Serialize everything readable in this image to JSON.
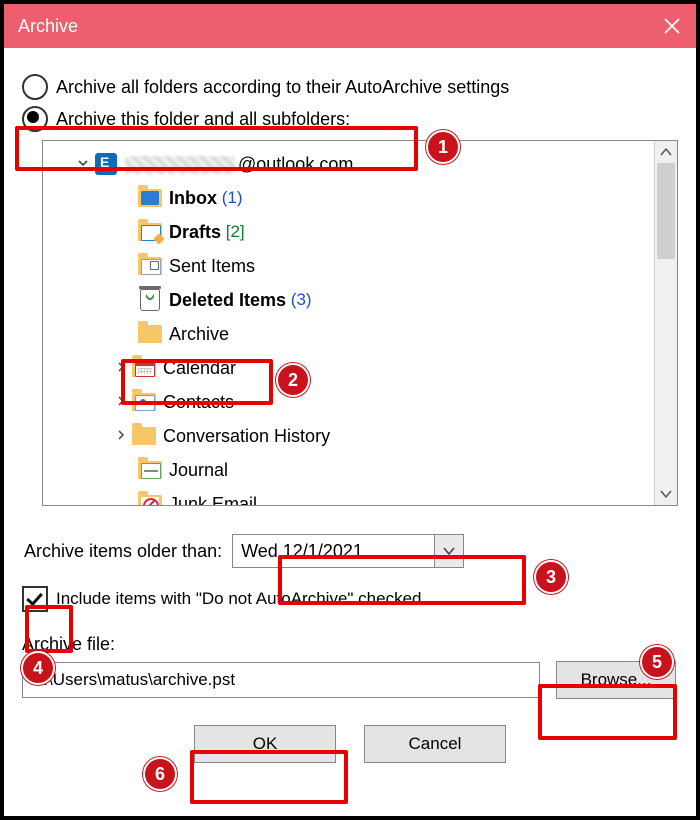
{
  "title": "Archive",
  "radio_all": "Archive all folders according to their AutoArchive settings",
  "radio_this": "Archive this folder and all subfolders:",
  "tree": {
    "root_suffix": "@outlook.com",
    "inbox": "Inbox",
    "inbox_count": "(1)",
    "drafts": "Drafts",
    "drafts_count": "[2]",
    "sent": "Sent Items",
    "deleted": "Deleted Items",
    "deleted_count": "(3)",
    "archive": "Archive",
    "calendar": "Calendar",
    "contacts": "Contacts",
    "conversation": "Conversation History",
    "journal": "Journal",
    "junk": "Junk Email"
  },
  "older_label": "Archive items older than:",
  "older_value": "Wed 12/1/2021",
  "include_label": "Include items with \"Do not AutoArchive\" checked",
  "file_label": "Archive file:",
  "file_value": "C:\\Users\\matus\\archive.pst",
  "browse": "Browse...",
  "ok": "OK",
  "cancel": "Cancel",
  "badges": {
    "b1": "1",
    "b2": "2",
    "b3": "3",
    "b4": "4",
    "b5": "5",
    "b6": "6"
  }
}
